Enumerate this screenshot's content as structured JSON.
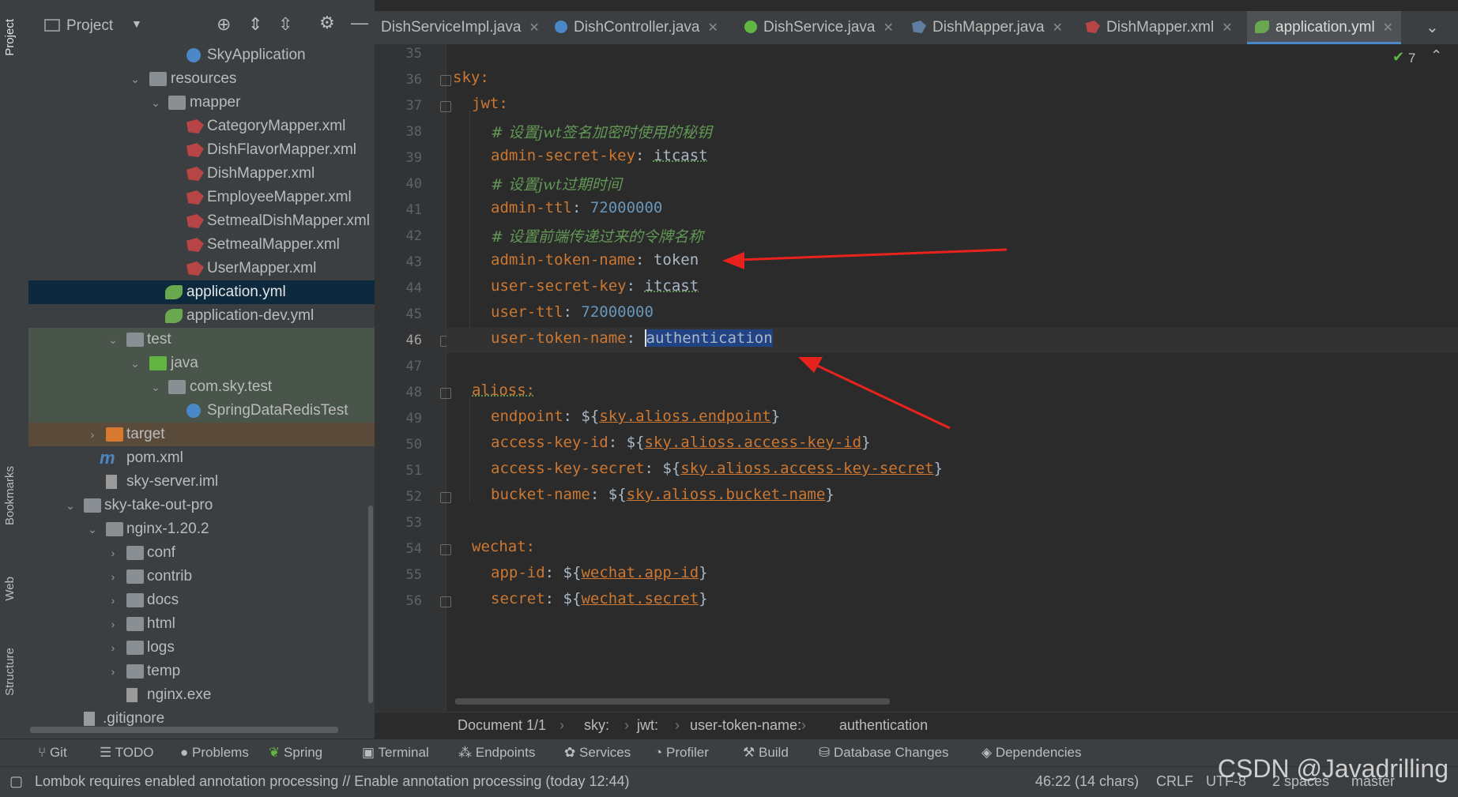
{
  "left_strip": {
    "tabs": [
      "Project",
      "Bookmarks",
      "Web",
      "Structure"
    ]
  },
  "project_panel": {
    "title": "Project",
    "tree": [
      {
        "label": "SkyApplication",
        "kind": "class"
      },
      {
        "label": "resources",
        "kind": "folder"
      },
      {
        "label": "mapper",
        "kind": "folder"
      },
      {
        "label": "CategoryMapper.xml",
        "kind": "xml"
      },
      {
        "label": "DishFlavorMapper.xml",
        "kind": "xml"
      },
      {
        "label": "DishMapper.xml",
        "kind": "xml"
      },
      {
        "label": "EmployeeMapper.xml",
        "kind": "xml"
      },
      {
        "label": "SetmealDishMapper.xml",
        "kind": "xml"
      },
      {
        "label": "SetmealMapper.xml",
        "kind": "xml"
      },
      {
        "label": "UserMapper.xml",
        "kind": "xml"
      },
      {
        "label": "application.yml",
        "kind": "yml",
        "selected": true
      },
      {
        "label": "application-dev.yml",
        "kind": "yml"
      },
      {
        "label": "test",
        "kind": "folder"
      },
      {
        "label": "java",
        "kind": "folder-green"
      },
      {
        "label": "com.sky.test",
        "kind": "package"
      },
      {
        "label": "SpringDataRedisTest",
        "kind": "class"
      },
      {
        "label": "target",
        "kind": "folder-orange"
      },
      {
        "label": "pom.xml",
        "kind": "maven"
      },
      {
        "label": "sky-server.iml",
        "kind": "file"
      },
      {
        "label": "sky-take-out-pro",
        "kind": "folder"
      },
      {
        "label": "nginx-1.20.2",
        "kind": "folder"
      },
      {
        "label": "conf",
        "kind": "folder"
      },
      {
        "label": "contrib",
        "kind": "folder"
      },
      {
        "label": "docs",
        "kind": "folder"
      },
      {
        "label": "html",
        "kind": "folder"
      },
      {
        "label": "logs",
        "kind": "folder"
      },
      {
        "label": "temp",
        "kind": "folder"
      },
      {
        "label": "nginx.exe",
        "kind": "file"
      },
      {
        "label": ".gitignore",
        "kind": "file"
      }
    ]
  },
  "tabs": [
    {
      "label": "DishServiceImpl.java",
      "icon": "java-class-icon"
    },
    {
      "label": "DishController.java",
      "icon": "class-icon"
    },
    {
      "label": "DishService.java",
      "icon": "interface-icon"
    },
    {
      "label": "DishMapper.java",
      "icon": "mapper-icon"
    },
    {
      "label": "DishMapper.xml",
      "icon": "xml-icon"
    },
    {
      "label": "application.yml",
      "icon": "yml-icon",
      "active": true
    }
  ],
  "inspection": {
    "count": "7"
  },
  "editor": {
    "line_numbers": [
      "35",
      "36",
      "37",
      "38",
      "39",
      "40",
      "41",
      "42",
      "43",
      "44",
      "45",
      "46",
      "47",
      "48",
      "49",
      "50",
      "51",
      "52",
      "53",
      "54",
      "55",
      "56"
    ],
    "lines": {
      "l36": {
        "key": "sky:"
      },
      "l37": {
        "key": "jwt:"
      },
      "l38": {
        "comment": "# 设置jwt签名加密时使用的秘钥"
      },
      "l39": {
        "key": "admin-secret-key",
        "value": "itcast"
      },
      "l40": {
        "comment": "# 设置jwt过期时间"
      },
      "l41": {
        "key": "admin-ttl",
        "value": "72000000"
      },
      "l42": {
        "comment": "# 设置前端传递过来的令牌名称"
      },
      "l43": {
        "key": "admin-token-name",
        "value": "token"
      },
      "l44": {
        "key": "user-secret-key",
        "value": "itcast"
      },
      "l45": {
        "key": "user-ttl",
        "value": "72000000"
      },
      "l46": {
        "key": "user-token-name",
        "value": "authentication"
      },
      "l48": {
        "key": "alioss:"
      },
      "l49": {
        "key": "endpoint",
        "ref": "sky.alioss.endpoint"
      },
      "l50": {
        "key": "access-key-id",
        "ref": "sky.alioss.access-key-id"
      },
      "l51": {
        "key": "access-key-secret",
        "ref": "sky.alioss.access-key-secret"
      },
      "l52": {
        "key": "bucket-name",
        "ref": "sky.alioss.bucket-name"
      },
      "l54": {
        "key": "wechat:"
      },
      "l55": {
        "key": "app-id",
        "ref": "wechat.app-id"
      },
      "l56": {
        "key": "secret",
        "ref": "wechat.secret"
      }
    },
    "colon": ":",
    "ref_open": "${",
    "ref_close": "}"
  },
  "breadcrumb": [
    "Document 1/1",
    "sky:",
    "jwt:",
    "user-token-name:",
    "authentication"
  ],
  "tool_windows": [
    "Git",
    "TODO",
    "Problems",
    "Spring",
    "Terminal",
    "Endpoints",
    "Services",
    "Profiler",
    "Build",
    "Database Changes",
    "Dependencies"
  ],
  "status": {
    "message": "Lombok requires enabled annotation processing // Enable annotation processing (today 12:44)",
    "position": "46:22 (14 chars)",
    "line_sep": "CRLF",
    "encoding": "UTF-8",
    "indent": "2 spaces",
    "branch": "master"
  },
  "watermark": "CSDN @Javadrilling",
  "colors": {
    "selection": "#214283",
    "key": "#cc7832",
    "number": "#6897bb",
    "comment": "#629755",
    "arrow": "#e8221c"
  }
}
